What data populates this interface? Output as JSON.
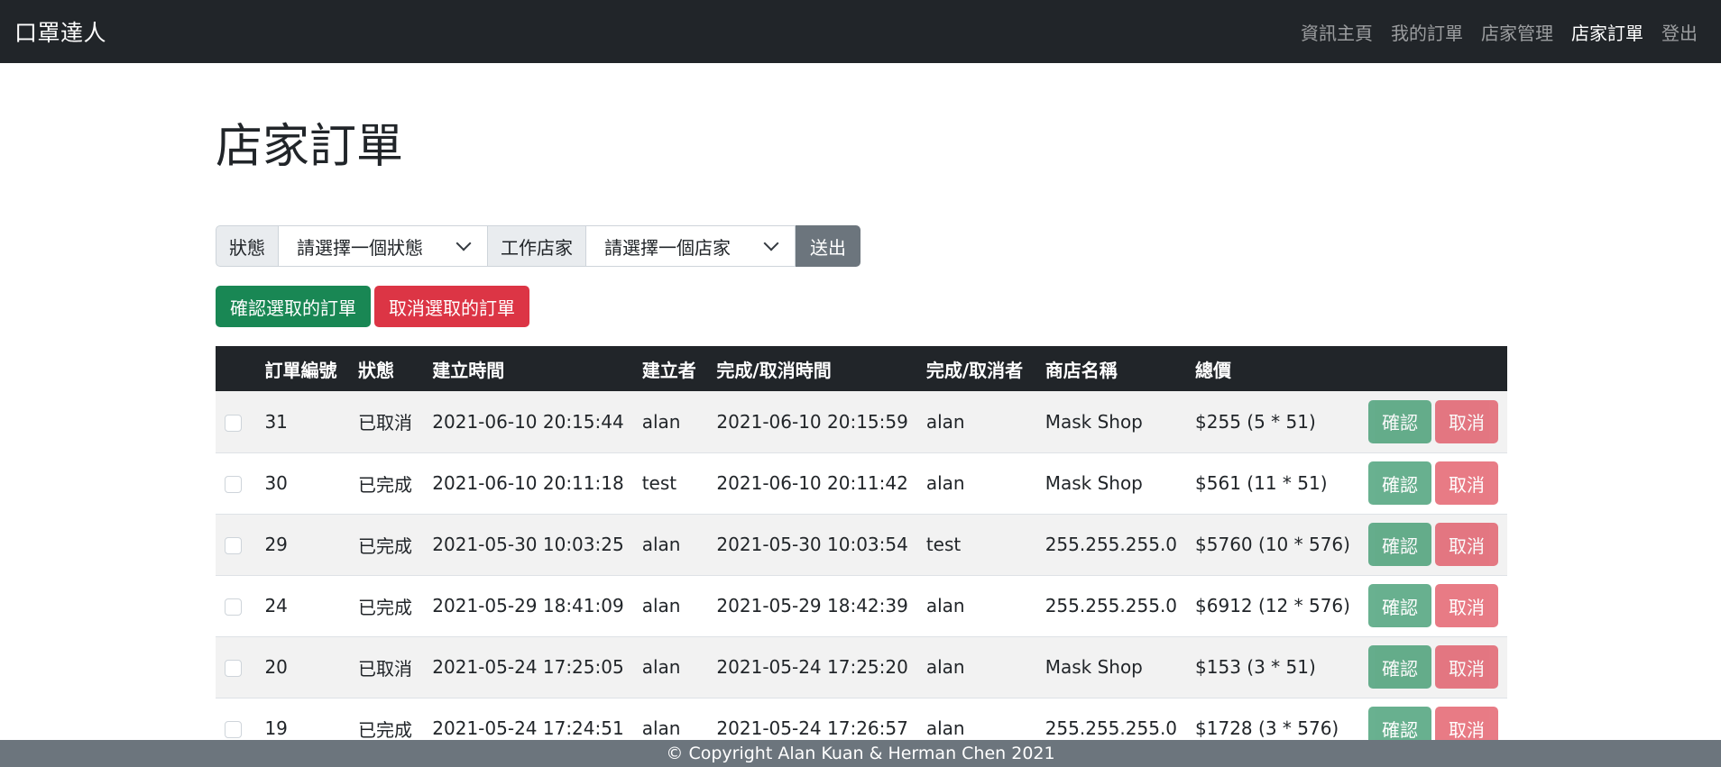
{
  "navbar": {
    "brand": "口罩達人",
    "links": [
      {
        "label": "資訊主頁",
        "active": false
      },
      {
        "label": "我的訂單",
        "active": false
      },
      {
        "label": "店家管理",
        "active": false
      },
      {
        "label": "店家訂單",
        "active": true
      },
      {
        "label": "登出",
        "active": false
      }
    ]
  },
  "page": {
    "title": "店家訂單"
  },
  "filters": {
    "status_label": "狀態",
    "status_select": "請選擇一個狀態",
    "shop_label": "工作店家",
    "shop_select": "請選擇一個店家",
    "submit": "送出"
  },
  "bulk_actions": {
    "confirm": "確認選取的訂單",
    "cancel": "取消選取的訂單"
  },
  "table": {
    "headers": [
      "訂單編號",
      "狀態",
      "建立時間",
      "建立者",
      "完成/取消時間",
      "完成/取消者",
      "商店名稱",
      "總價"
    ],
    "row_confirm": "確認",
    "row_cancel": "取消",
    "rows": [
      {
        "id": "31",
        "status": "已取消",
        "created": "2021-06-10 20:15:44",
        "creator": "alan",
        "finished": "2021-06-10 20:15:59",
        "finisher": "alan",
        "shop": "Mask Shop",
        "total": "$255 (5 * 51)"
      },
      {
        "id": "30",
        "status": "已完成",
        "created": "2021-06-10 20:11:18",
        "creator": "test",
        "finished": "2021-06-10 20:11:42",
        "finisher": "alan",
        "shop": "Mask Shop",
        "total": "$561 (11 * 51)"
      },
      {
        "id": "29",
        "status": "已完成",
        "created": "2021-05-30 10:03:25",
        "creator": "alan",
        "finished": "2021-05-30 10:03:54",
        "finisher": "test",
        "shop": "255.255.255.0",
        "total": "$5760 (10 * 576)"
      },
      {
        "id": "24",
        "status": "已完成",
        "created": "2021-05-29 18:41:09",
        "creator": "alan",
        "finished": "2021-05-29 18:42:39",
        "finisher": "alan",
        "shop": "255.255.255.0",
        "total": "$6912 (12 * 576)"
      },
      {
        "id": "20",
        "status": "已取消",
        "created": "2021-05-24 17:25:05",
        "creator": "alan",
        "finished": "2021-05-24 17:25:20",
        "finisher": "alan",
        "shop": "Mask Shop",
        "total": "$153 (3 * 51)"
      },
      {
        "id": "19",
        "status": "已完成",
        "created": "2021-05-24 17:24:51",
        "creator": "alan",
        "finished": "2021-05-24 17:26:57",
        "finisher": "alan",
        "shop": "255.255.255.0",
        "total": "$1728 (3 * 576)"
      }
    ]
  },
  "footer": {
    "text": "© Copyright Alan Kuan & Herman Chen 2021"
  }
}
